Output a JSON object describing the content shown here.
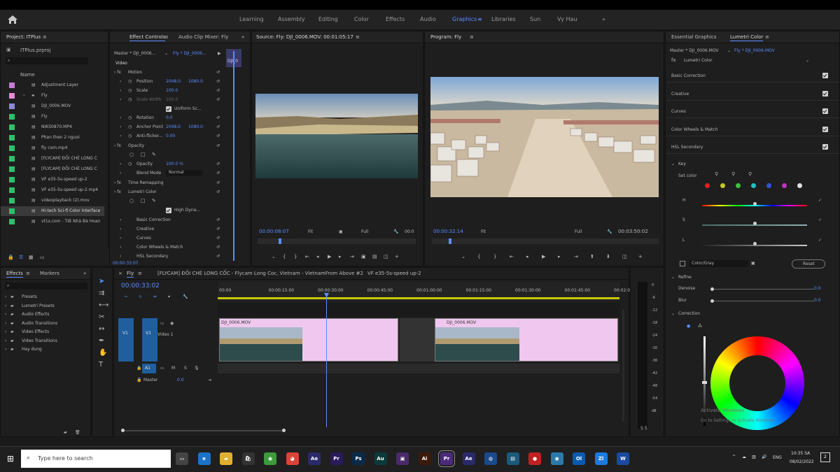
{
  "workspaces": [
    "Learning",
    "Assembly",
    "Editing",
    "Color",
    "Effects",
    "Audio",
    "Graphics",
    "Libraries",
    "Sun",
    "Vy Hau"
  ],
  "active_workspace": "Graphics",
  "project": {
    "tab": "Project: ITPlus",
    "file": "ITPlus.prproj",
    "col_name": "Name",
    "items": [
      {
        "name": "Adjustment Layer",
        "color": "#c77bd6"
      },
      {
        "name": "Fly",
        "color": "#e58ad6"
      },
      {
        "name": "DJI_0006.MOV",
        "color": "#8a8ad6"
      },
      {
        "name": "Fly",
        "color": "#2fbf6a"
      },
      {
        "name": "NIKS0870.MP4",
        "color": "#2fbf6a"
      },
      {
        "name": "Phan then 2 nguoi",
        "color": "#2fbf6a"
      },
      {
        "name": "fly cam.mp4",
        "color": "#2fbf6a"
      },
      {
        "name": "[FLYCAM] ĐỒI CHÈ LONG C",
        "color": "#2fbf6a"
      },
      {
        "name": "[FLYCAM] ĐỒI CHÈ LONG C",
        "color": "#2fbf6a"
      },
      {
        "name": "VF e35-5s-speed up-2",
        "color": "#2fbf6a"
      },
      {
        "name": "VF e35-5s-speed up-2.mp4",
        "color": "#2fbf6a"
      },
      {
        "name": "videoplayback (2).mov",
        "color": "#2fbf6a"
      },
      {
        "name": "Hi-tech Sci-fi Color interface",
        "color": "#2fbf6a"
      },
      {
        "name": "vt1s.com - Tết Nhà Bà Hoan",
        "color": "#2fbf6a"
      }
    ]
  },
  "effect_controls": {
    "tab1": "Effect Controls",
    "tab2": "Audio Clip Mixer: Fly",
    "master": "Master * DJI_0006...",
    "seq": "Fly * DJI_0006...",
    "clip_label": "DJI_0",
    "video": "Video",
    "motion": "Motion",
    "position": "Position",
    "pos_x": "2048.0",
    "pos_y": "1080.0",
    "scale": "Scale",
    "scale_v": "100.0",
    "scale_width": "Scale Width",
    "scale_width_v": "100.0",
    "uniform": "Uniform Sc...",
    "rotation": "Rotation",
    "rotation_v": "0.0",
    "anchor": "Anchor Point",
    "anchor_x": "2048.0",
    "anchor_y": "1080.0",
    "anti": "Anti-flicker...",
    "anti_v": "0.00",
    "opacity": "Opacity",
    "opacity_row": "Opacity",
    "opacity_v": "100.0 %",
    "blend": "Blend Mode",
    "blend_v": "Normal",
    "time_remap": "Time Remapping",
    "lumetri": "Lumetri Color",
    "high_dyn": "High Dyna...",
    "basic": "Basic Correction",
    "creative": "Creative",
    "curves": "Curves",
    "wheels": "Color Wheels & Match",
    "hsl": "HSL Secondary",
    "timecode": "00:00:33:07"
  },
  "source": {
    "tab": "Source: Fly: DJI_0006.MOV: 00:01:05:17",
    "tc": "00:00:08:07",
    "fit": "Fit",
    "full": "Full",
    "tc2": "00:0"
  },
  "program": {
    "tab": "Program: Fly",
    "tc": "00:00:32:14",
    "fit": "Fit",
    "full": "Full",
    "dur": "00:03:50:02"
  },
  "lumetri": {
    "tab1": "Essential Graphics",
    "tab2": "Lumetri Color",
    "master": "Master * DJI_0006.MOV",
    "seq": "Fly * DJI_0006.MOV",
    "effect": "Lumetri Color",
    "sections": [
      "Basic Correction",
      "Creative",
      "Curves",
      "Color Wheels & Match",
      "HSL Secondary"
    ],
    "key": "Key",
    "set_color": "Set color",
    "h": "H",
    "s": "S",
    "l": "L",
    "color_gray": "Color/Gray",
    "reset": "Reset",
    "refine": "Refine",
    "denoise": "Denoise",
    "denoise_v": "0.0",
    "blur": "Blur",
    "blur_v": "0.0",
    "correction": "Correction",
    "activate": "Activate Windows",
    "goto": "Go to Settings to activate Windows."
  },
  "effects": {
    "tab1": "Effects",
    "tab2": "Markers",
    "items": [
      "Presets",
      "Lumetri Presets",
      "Audio Effects",
      "Audio Transitions",
      "Video Effects",
      "Video Transitions",
      "Hay dung"
    ]
  },
  "timeline": {
    "tab": "Fly",
    "tabs": [
      "[FLYCAM] ĐỒI CHÈ LONG CỐC - Flycam Long Coc, Vietnam - VietnamFrom Above #2",
      "VF e35-5s-speed up-2"
    ],
    "tc": "00:00:33:02",
    "ruler": [
      "00:00",
      "00:00:15:00",
      "00:00:30:00",
      "00:00:45:00",
      "00:01:00:00",
      "00:01:15:00",
      "00:01:30:00",
      "00:01:45:00",
      "00:02:00"
    ],
    "v1": "V1",
    "video1": "Video 1",
    "a1": "A1",
    "master": "Master",
    "master_v": "0.0",
    "clip1": "DJI_0006.MOV",
    "clip2": "DJI_0006.MOV"
  },
  "meter": {
    "labels": [
      "0",
      "-6",
      "-12",
      "-18",
      "-24",
      "-30",
      "-36",
      "-42",
      "-48",
      "-54",
      "dB"
    ],
    "bottom": "S S"
  },
  "taskbar": {
    "search": "Type here to search",
    "lang": "ENG",
    "time": "10:35 SA",
    "date": "08/02/2022",
    "notif": "2"
  }
}
